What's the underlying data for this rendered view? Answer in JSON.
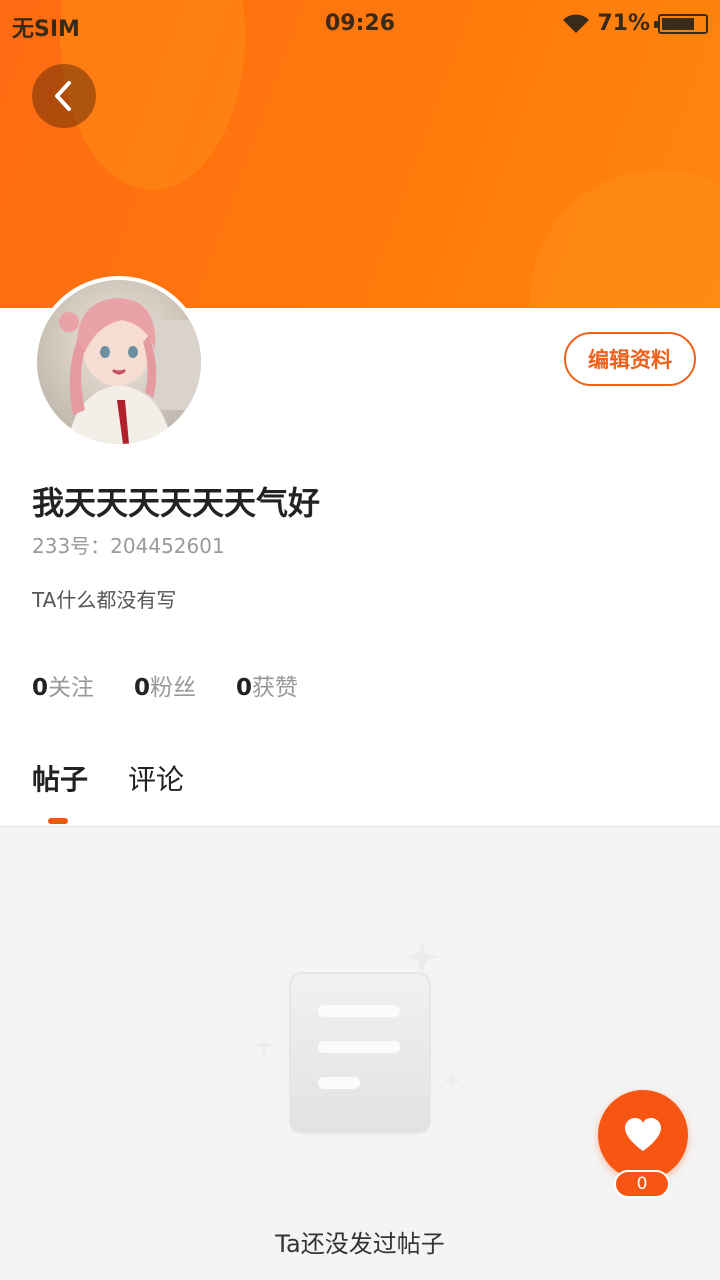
{
  "status_bar": {
    "carrier": "无SIM",
    "time": "09:26",
    "battery": "71%"
  },
  "profile": {
    "username": "我天天天天天天气好",
    "user_id": "233号：204452601",
    "bio": "TA什么都没有写",
    "edit_button": "编辑资料"
  },
  "stats": [
    {
      "count": "0",
      "label": "关注"
    },
    {
      "count": "0",
      "label": "粉丝"
    },
    {
      "count": "0",
      "label": "获赞"
    }
  ],
  "tabs": [
    {
      "label": "帖子",
      "active": true
    },
    {
      "label": "评论",
      "active": false
    }
  ],
  "empty_state": {
    "text": "Ta还没发过帖子"
  },
  "like": {
    "count": "0"
  },
  "colors": {
    "accent": "#f65512",
    "header_gradient_start": "#ff6a13",
    "header_gradient_end": "#ff860e"
  },
  "icons": {
    "back": "chevron-left-icon",
    "like": "heart-icon",
    "wifi": "wifi-icon",
    "battery": "battery-icon"
  }
}
